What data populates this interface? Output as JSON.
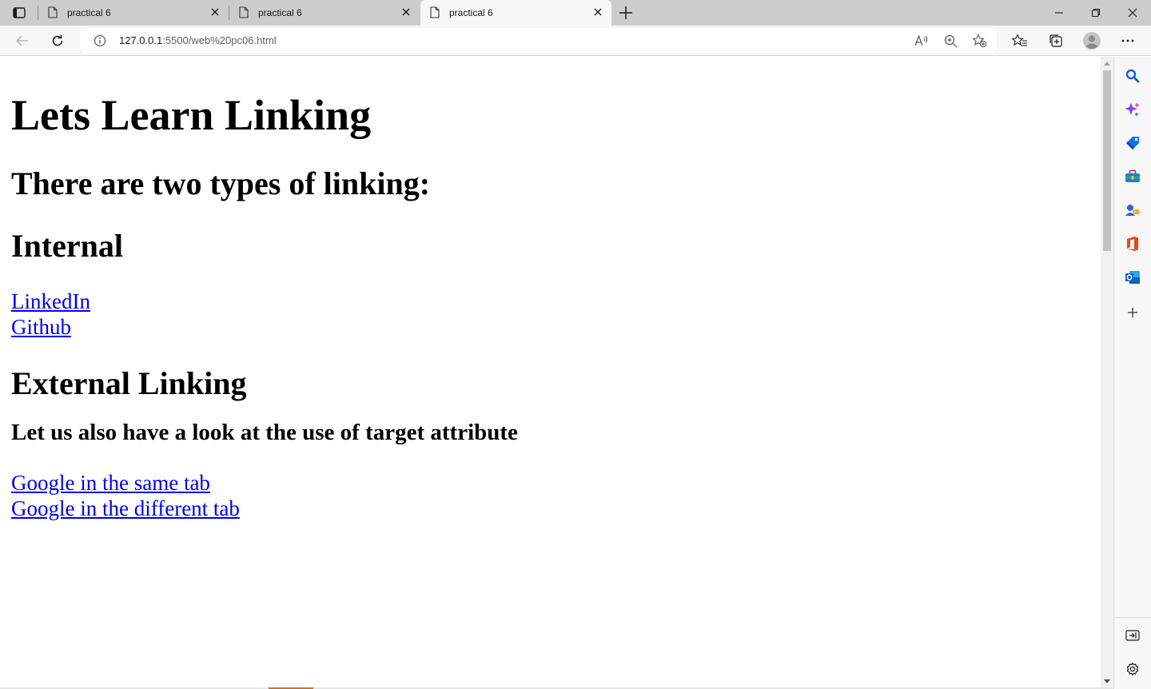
{
  "browser": {
    "tabs": [
      {
        "title": "practical 6",
        "active": false
      },
      {
        "title": "practical 6",
        "active": false
      },
      {
        "title": "practical 6",
        "active": true
      }
    ],
    "address": {
      "host": "127.0.0.1",
      "rest": ":5500/web%20pc06.html"
    },
    "colors": {
      "accent": "#0f6cbd",
      "link": "#0000ee"
    }
  },
  "page": {
    "h1": "Lets Learn Linking",
    "h2_types": "There are two types of linking:",
    "h2_internal": "Internal",
    "internal_links": [
      "LinkedIn",
      "Github"
    ],
    "h2_external": "External Linking",
    "h3_target": "Let us also have a look at the use of target attribute",
    "external_links": [
      "Google in the same tab",
      "Google in the different tab"
    ]
  },
  "sidebar": {
    "icons": [
      "search-icon",
      "copilot-icon",
      "shopping-icon",
      "tools-icon",
      "games-icon",
      "office-icon",
      "outlook-icon",
      "add-icon",
      "hide-sidebar-icon",
      "settings-icon"
    ]
  }
}
